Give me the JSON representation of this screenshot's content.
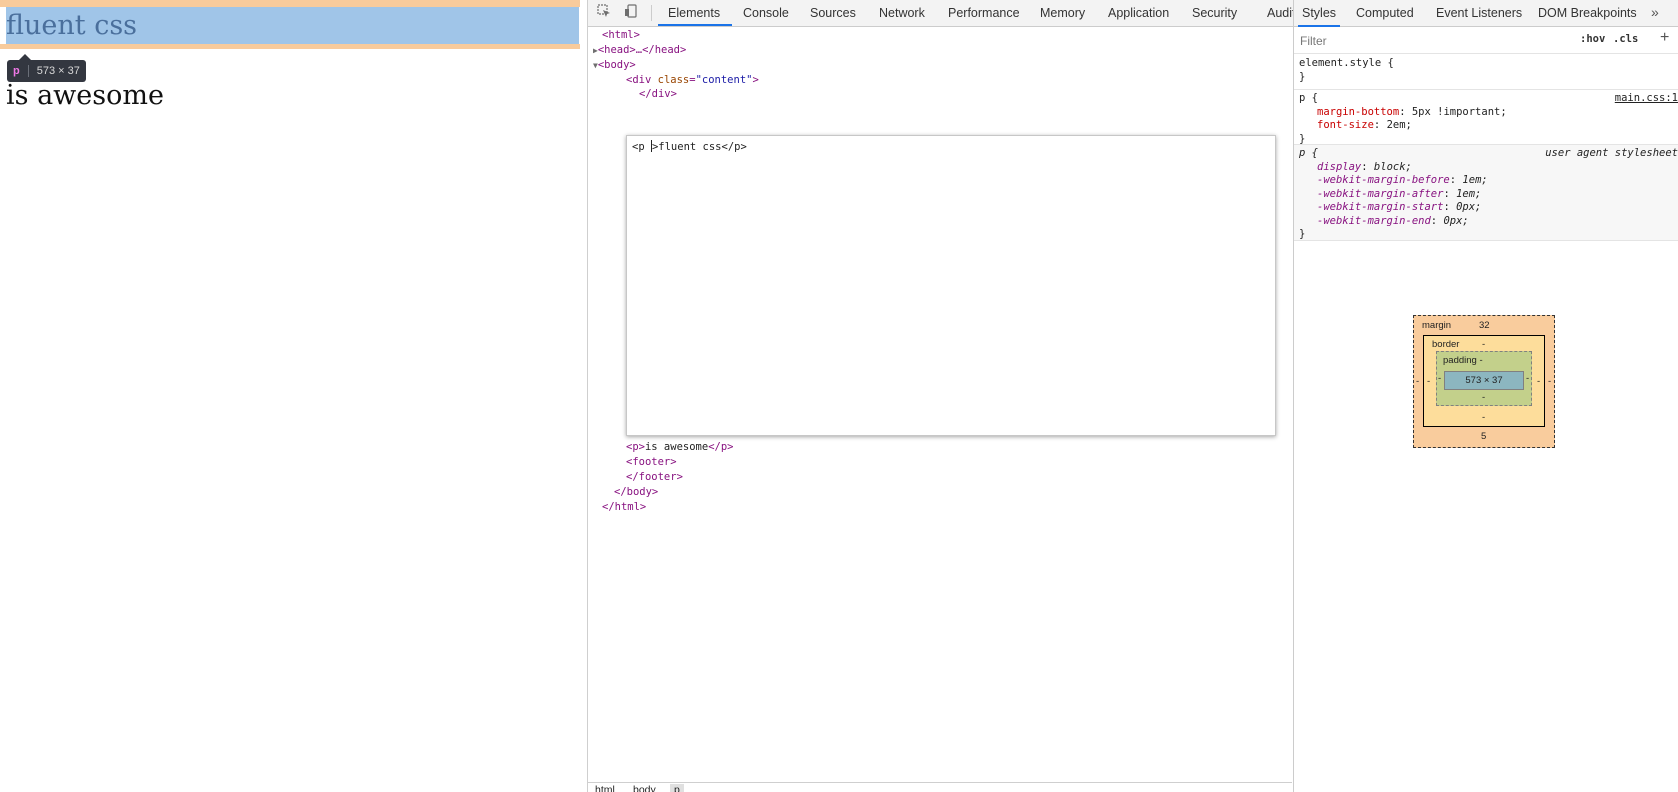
{
  "viewport": {
    "paragraph1": "fluent css",
    "paragraph2": "is awesome",
    "tooltip_tag": "p",
    "tooltip_size": "573 × 37"
  },
  "toolbar": {
    "icons": [
      "inspect-element-icon",
      "device-toolbar-icon",
      "kebab-menu-icon",
      "close-icon"
    ],
    "tabs": [
      "Elements",
      "Console",
      "Sources",
      "Network",
      "Performance",
      "Memory",
      "Application",
      "Security",
      "Audits"
    ],
    "active_tab": "Elements"
  },
  "dom": {
    "lines": {
      "html_open": "<html>",
      "head": "<head>…</head>",
      "body_open": "<body>",
      "div_open_tag": "div",
      "div_attr": "class",
      "div_attr_val": "\"content\"",
      "div_close": "</div>",
      "p2": "is awesome",
      "footer_open": "<footer>",
      "footer_close": "</footer>",
      "body_close": "</body>",
      "html_close": "</html>"
    },
    "edit_before_caret": "<p ",
    "edit_after_caret": ">fluent css</p>"
  },
  "breadcrumb": [
    "html",
    "body",
    "p"
  ],
  "styles": {
    "tabs": [
      "Styles",
      "Computed",
      "Event Listeners",
      "DOM Breakpoints"
    ],
    "active_tab": "Styles",
    "more_icon": "chevron-double-right-icon",
    "filter_placeholder": "Filter",
    "hov": ":hov",
    "cls": ".cls",
    "plus": "+",
    "rules": [
      {
        "selector": "element.style {",
        "close": "}",
        "source": "",
        "decls": []
      },
      {
        "selector": "p {",
        "close": "}",
        "source": "main.css:1",
        "decls": [
          {
            "prop": "margin-bottom",
            "value": "5px !important;"
          },
          {
            "prop": "font-size",
            "value": "2em;"
          }
        ]
      },
      {
        "selector": "p {",
        "close": "}",
        "source": "user agent stylesheet",
        "decls": [
          {
            "prop": "display",
            "value": "block;"
          },
          {
            "prop": "-webkit-margin-before",
            "value": "1em;"
          },
          {
            "prop": "-webkit-margin-after",
            "value": "1em;"
          },
          {
            "prop": "-webkit-margin-start",
            "value": "0px;"
          },
          {
            "prop": "-webkit-margin-end",
            "value": "0px;"
          }
        ]
      }
    ]
  },
  "box_model": {
    "margin_label": "margin",
    "margin_top": "32",
    "margin_bottom": "5",
    "margin_left": "-",
    "margin_right": "-",
    "border_label": "border",
    "border_top": "-",
    "border_bottom": "-",
    "border_left": "-",
    "border_right": "-",
    "padding_label": "padding -",
    "padding_bottom": "-",
    "padding_left": "-",
    "padding_right": "-",
    "content": "573 × 37"
  },
  "colors": {
    "margin": "#f9cc9d",
    "border": "#fddd9b",
    "padding": "#c3d08b",
    "content": "#8cb6c0",
    "active_tab": "#1a73e8",
    "highlight_content": "#a0c5e8",
    "highlight_margin": "#f8cb9c"
  }
}
